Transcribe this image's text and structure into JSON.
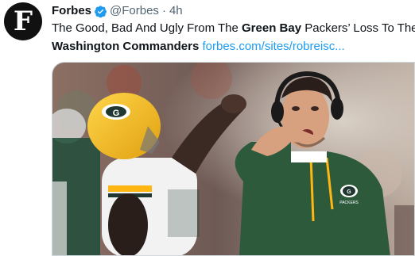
{
  "tweet": {
    "avatar_letter": "F",
    "author_name": "Forbes",
    "handle": "@Forbes",
    "separator": "·",
    "time": "4h",
    "text": {
      "part1": "The Good, Bad And Ugly From The ",
      "bold1": "Green Bay",
      "part2": " Packers’ Loss To The",
      "bold2": "Washington Commanders",
      "link": "forbes.com/sites/robreisc..."
    },
    "media": {
      "logo_letter": "G",
      "badge_letter": "G",
      "badge_text": "PACKERS"
    }
  },
  "colors": {
    "link": "#1d9bf0",
    "verified": "#1d9bf0",
    "packers_green": "#203731",
    "packers_gold": "#ffb612"
  }
}
